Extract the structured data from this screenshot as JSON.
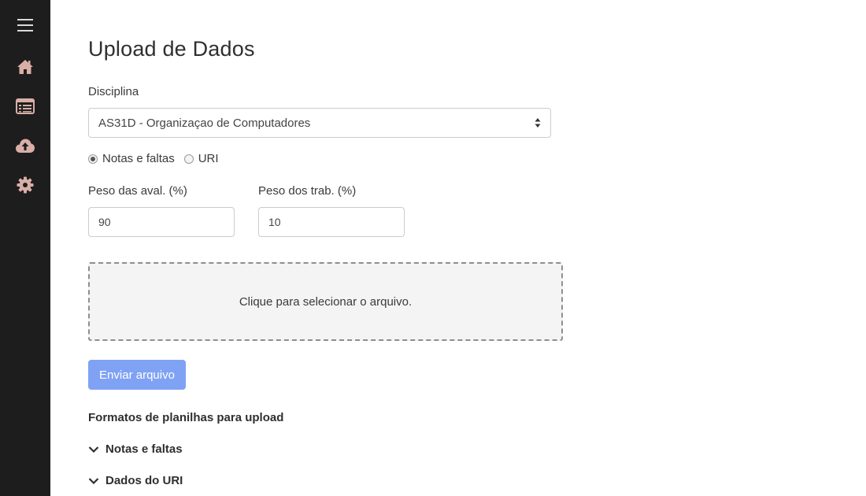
{
  "sidebar": {
    "items": [
      {
        "icon": "menu-icon",
        "color": "#d9d9d9"
      },
      {
        "icon": "home-icon",
        "color": "#d8aea6"
      },
      {
        "icon": "list-icon",
        "color": "#d8aea6"
      },
      {
        "icon": "cloud-upload-icon",
        "color": "#d8aea6"
      },
      {
        "icon": "gear-icon",
        "color": "#d8aea6"
      }
    ]
  },
  "page": {
    "title": "Upload de Dados"
  },
  "form": {
    "discipline_label": "Disciplina",
    "discipline_selected": "AS31D - Organizaçao de Computadores",
    "radio_options": [
      {
        "label": "Notas e faltas",
        "checked": true
      },
      {
        "label": "URI",
        "checked": false
      }
    ],
    "eval_weight_label": "Peso das aval. (%)",
    "eval_weight_value": "90",
    "work_weight_label": "Peso dos trab. (%)",
    "work_weight_value": "10",
    "dropzone_text": "Clique para selecionar o arquivo.",
    "submit_label": "Enviar arquivo"
  },
  "formats": {
    "heading": "Formatos de planilhas para upload",
    "sections": [
      {
        "label": "Notas e faltas"
      },
      {
        "label": "Dados do URI"
      }
    ]
  },
  "colors": {
    "sidebar_bg": "#1d1d1d",
    "icon_accent": "#d8aea6",
    "button_primary": "#7fa2f5"
  }
}
